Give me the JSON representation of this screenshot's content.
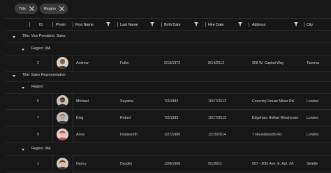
{
  "groupby": {
    "chips": [
      {
        "label": "Title"
      },
      {
        "label": "Region"
      }
    ]
  },
  "header": {
    "columns": {
      "id": "ID",
      "photo": "Photo",
      "first_name": "First Name",
      "last_name": "Last Name",
      "birth_date": "Birth Date",
      "hire_date": "Hire Date",
      "address": "Address",
      "city": "City"
    }
  },
  "groups": {
    "g1": "Title: Vice President, Sales",
    "g1r": "Region: WA",
    "g2": "Title: Sales Representative",
    "g2r": "Region:",
    "g2r2": "Region: WA"
  },
  "rows": [
    {
      "id": "2",
      "first": "Andrew",
      "last": "Fuller",
      "birth": "2/19/1972",
      "hire": "8/14/2012",
      "address": "908 W. Capital Way",
      "city": "Tacoma"
    },
    {
      "id": "6",
      "first": "Michael",
      "last": "Suyama",
      "birth": "7/2/1983",
      "hire": "10/17/2013",
      "address": "Coventry House Miner Rd.",
      "city": "London"
    },
    {
      "id": "7",
      "first": "King",
      "last": "Robert",
      "birth": "7/2/1983",
      "hire": "10/17/2013",
      "address": "Edgeham Hollow Winchester",
      "city": "London"
    },
    {
      "id": "9",
      "first": "Anne",
      "last": "Dodsworth",
      "birth": "1/27/1986",
      "hire": "11/15/2014",
      "address": "7 Houndstooth Rd.",
      "city": "London"
    },
    {
      "id": "1",
      "first": "Nancy",
      "last": "Davolio",
      "birth": "12/8/1968",
      "hire": "5/1/2011",
      "address": "507 - 20th Ave. E. Apt. 2A",
      "city": "Seattle"
    }
  ],
  "colors": {
    "background": "#171717",
    "chip": "#3a3a3a",
    "text": "#d6d6d6",
    "border": "#2a2a2a"
  }
}
